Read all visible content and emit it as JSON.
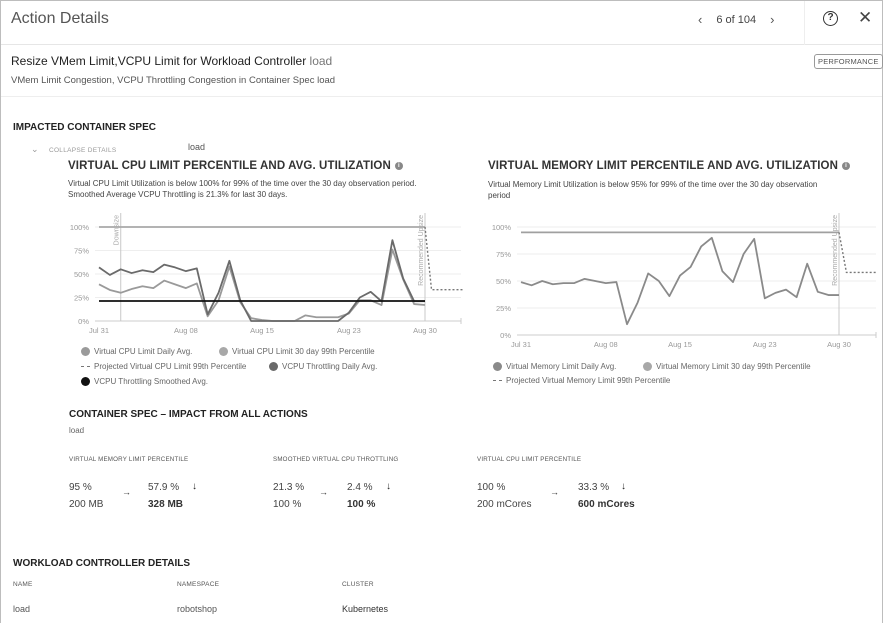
{
  "header": {
    "title": "Action Details",
    "pager": {
      "current": 6,
      "total": 104,
      "text": "6 of 104",
      "prev_icon": "chevron-left-icon",
      "next_icon": "chevron-right-icon"
    },
    "help_icon": "?",
    "close_icon": "✕"
  },
  "action": {
    "title": "Resize VMem Limit,VCPU Limit for Workload Controller",
    "entity": "load",
    "subtitle": "VMem Limit Congestion, VCPU Throttling Congestion in Container Spec load",
    "badge": "PERFORMANCE"
  },
  "impacted": {
    "title": "IMPACTED CONTAINER SPEC",
    "collapse_label": "COLLAPSE DETAILS",
    "collapse_icon": "⌄",
    "entity": "load"
  },
  "chart_data": [
    {
      "type": "line",
      "title": "VIRTUAL CPU LIMIT PERCENTILE AND AVG. UTILIZATION",
      "description_line1": "Virtual CPU Limit Utilization is below 100% for 99% of the time over the 30 day observation period.",
      "description_line2": "Smoothed Average VCPU Throttling is 21.3% for last 30 days.",
      "ylim": [
        0,
        100
      ],
      "yticks": [
        "0%",
        "25%",
        "50%",
        "75%",
        "100%"
      ],
      "xticks": [
        "Jul 31",
        "Aug 08",
        "Aug 15",
        "Aug 23",
        "Aug 30"
      ],
      "xtick_days": [
        0,
        8,
        15,
        23,
        30
      ],
      "annotations": [
        {
          "label": "Downsize",
          "day": 2
        },
        {
          "label": "Recommended Upsize",
          "day": 30
        }
      ],
      "grid": true,
      "series": [
        {
          "name": "Virtual CPU Limit Daily Avg.",
          "color": "#9a9a9a",
          "values": [
            39,
            33,
            30,
            34,
            37,
            35,
            43,
            39,
            35,
            40,
            5,
            22,
            58,
            20,
            3,
            1,
            0,
            0,
            0,
            6,
            4,
            4,
            4,
            8,
            22,
            22,
            17,
            76,
            44,
            18,
            17
          ]
        },
        {
          "name": "Virtual CPU Limit 30 day 99th Percentile",
          "color": "#a8a8a8",
          "values": [
            100,
            100,
            100,
            100,
            100,
            100,
            100,
            100,
            100,
            100,
            100,
            100,
            100,
            100,
            100,
            100,
            100,
            100,
            100,
            100,
            100,
            100,
            100,
            100,
            100,
            100,
            100,
            100,
            100,
            100,
            100
          ]
        },
        {
          "name": "Projected Virtual CPU Limit 99th Percentile",
          "color": "#777777",
          "dashed": true,
          "points": [
            [
              30,
              100
            ],
            [
              30.6,
              33.3
            ],
            [
              33.5,
              33.3
            ]
          ]
        },
        {
          "name": "VCPU Throttling Daily Avg.",
          "color": "#6a6a6a",
          "values": [
            57,
            49,
            55,
            51,
            54,
            52,
            60,
            57,
            53,
            56,
            7,
            30,
            64,
            22,
            0,
            0,
            0,
            0,
            0,
            0,
            0,
            0,
            0,
            9,
            25,
            31,
            21,
            86,
            45,
            21,
            21
          ]
        },
        {
          "name": "VCPU Throttling Smoothed Avg.",
          "color": "#111111",
          "values": [
            21.3,
            21.3,
            21.3,
            21.3,
            21.3,
            21.3,
            21.3,
            21.3,
            21.3,
            21.3,
            21.3,
            21.3,
            21.3,
            21.3,
            21.3,
            21.3,
            21.3,
            21.3,
            21.3,
            21.3,
            21.3,
            21.3,
            21.3,
            21.3,
            21.3,
            21.3,
            21.3,
            21.3,
            21.3,
            21.3,
            21.3
          ]
        }
      ],
      "legend": [
        {
          "label": "Virtual CPU Limit Daily Avg.",
          "marker": "dot",
          "color": "#9a9a9a"
        },
        {
          "label": "Virtual CPU Limit 30 day 99th Percentile",
          "marker": "dot",
          "color": "#a8a8a8"
        },
        {
          "label": "Projected Virtual CPU Limit 99th Percentile",
          "marker": "dash",
          "color": "#777777"
        },
        {
          "label": "VCPU Throttling Daily Avg.",
          "marker": "dot",
          "color": "#6a6a6a"
        },
        {
          "label": "VCPU Throttling Smoothed Avg.",
          "marker": "dot",
          "color": "#111111"
        }
      ],
      "legend_position": "bottom"
    },
    {
      "type": "line",
      "title": "VIRTUAL MEMORY LIMIT PERCENTILE AND AVG. UTILIZATION",
      "description_line1": "Virtual Memory Limit Utilization is below 95% for 99% of the time over the 30 day observation",
      "description_line2": "period",
      "ylim": [
        0,
        100
      ],
      "yticks": [
        "0%",
        "25%",
        "50%",
        "75%",
        "100%"
      ],
      "xticks": [
        "Jul 31",
        "Aug 08",
        "Aug 15",
        "Aug 23",
        "Aug 30"
      ],
      "xtick_days": [
        0,
        8,
        15,
        23,
        30
      ],
      "annotations": [
        {
          "label": "Recommended Upsize",
          "day": 30
        }
      ],
      "grid": true,
      "series": [
        {
          "name": "Virtual Memory Limit Daily Avg.",
          "color": "#8a8a8a",
          "values": [
            49,
            46,
            50,
            47,
            48,
            48,
            52,
            50,
            48,
            49,
            10,
            30,
            57,
            50,
            36,
            55,
            63,
            82,
            90,
            59,
            49,
            75,
            89,
            34,
            39,
            42,
            35,
            66,
            40,
            37,
            37
          ]
        },
        {
          "name": "Virtual Memory Limit 30 day 99th Percentile",
          "color": "#a0a0a0",
          "values": [
            95,
            95,
            95,
            95,
            95,
            95,
            95,
            95,
            95,
            95,
            95,
            95,
            95,
            95,
            95,
            95,
            95,
            95,
            95,
            95,
            95,
            95,
            95,
            95,
            95,
            95,
            95,
            95,
            95,
            95,
            95
          ]
        },
        {
          "name": "Projected Virtual Memory Limit 99th Percentile",
          "color": "#777777",
          "dashed": true,
          "points": [
            [
              30,
              95
            ],
            [
              30.7,
              57.9
            ],
            [
              33.5,
              57.9
            ]
          ]
        }
      ],
      "legend": [
        {
          "label": "Virtual Memory Limit Daily Avg.",
          "marker": "dot",
          "color": "#8a8a8a"
        },
        {
          "label": "Virtual Memory Limit 30 day 99th Percentile",
          "marker": "dot",
          "color": "#a8a8a8"
        },
        {
          "label": "Projected Virtual Memory Limit 99th Percentile",
          "marker": "dash",
          "color": "#777777"
        }
      ],
      "legend_position": "bottom"
    }
  ],
  "impact": {
    "title": "CONTAINER SPEC – IMPACT FROM ALL ACTIONS",
    "entity": "load",
    "metrics": [
      {
        "label": "VIRTUAL MEMORY LIMIT PERCENTILE",
        "from_pct": "95 %",
        "from_cap": "200 MB",
        "to_pct": "57.9 %",
        "to_cap": "328 MB",
        "arrow": "→",
        "trend_icon": "🡓"
      },
      {
        "label": "SMOOTHED VIRTUAL CPU THROTTLING",
        "from_pct": "21.3 %",
        "from_cap": "100 %",
        "to_pct": "2.4 %",
        "to_cap": "100 %",
        "arrow": "→",
        "trend_icon": "🡓"
      },
      {
        "label": "VIRTUAL CPU LIMIT PERCENTILE",
        "from_pct": "100 %",
        "from_cap": "200 mCores",
        "to_pct": "33.3 %",
        "to_cap": "600 mCores",
        "arrow": "→",
        "trend_icon": "🡓"
      }
    ]
  },
  "workload": {
    "title": "WORKLOAD CONTROLLER DETAILS",
    "columns": [
      "NAME",
      "NAMESPACE",
      "CLUSTER"
    ],
    "values": [
      "load",
      "robotshop",
      "Kubernetes"
    ]
  }
}
